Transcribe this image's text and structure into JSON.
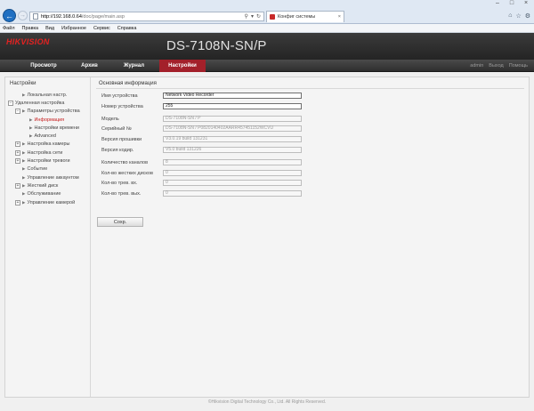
{
  "browser": {
    "url_host": "http://192.168.0.64",
    "url_path": "/doc/page/main.asp",
    "tab_title": "Конфиг системы",
    "menu": [
      "Файл",
      "Правка",
      "Вид",
      "Избранное",
      "Сервис",
      "Справка"
    ]
  },
  "header": {
    "logo": "HIKVISION",
    "model": "DS-7108N-SN/P"
  },
  "nav": {
    "tabs": [
      {
        "label": "Просмотр"
      },
      {
        "label": "Архив"
      },
      {
        "label": "Журнал"
      },
      {
        "label": "Настройки"
      }
    ],
    "active_index": 3,
    "user_links": [
      "admin",
      "Выход",
      "Помощь"
    ]
  },
  "sidebar": {
    "title": "Настройки",
    "items": [
      {
        "label": "Локальная настр.",
        "level": 1,
        "expander": ""
      },
      {
        "label": "Удаленная настройка",
        "level": 0,
        "expander": "−"
      },
      {
        "label": "Параметры устройства",
        "level": 1,
        "expander": "−"
      },
      {
        "label": "Информация",
        "level": 2,
        "expander": "",
        "active": true
      },
      {
        "label": "Настройки времени",
        "level": 2,
        "expander": ""
      },
      {
        "label": "Advanced",
        "level": 2,
        "expander": ""
      },
      {
        "label": "Настройка камеры",
        "level": 1,
        "expander": "+"
      },
      {
        "label": "Настройка сети",
        "level": 1,
        "expander": "+"
      },
      {
        "label": "Настройки тревоги",
        "level": 1,
        "expander": "+"
      },
      {
        "label": "Событие",
        "level": 1,
        "expander": ""
      },
      {
        "label": "Управление аккаунтом",
        "level": 1,
        "expander": ""
      },
      {
        "label": "Жесткий диск",
        "level": 1,
        "expander": "+"
      },
      {
        "label": "Обслуживание",
        "level": 1,
        "expander": ""
      },
      {
        "label": "Управление камерой",
        "level": 1,
        "expander": "+"
      }
    ]
  },
  "main": {
    "section_title": "Основная информация",
    "fields": [
      {
        "label": "Имя устройства",
        "value": "Network Video Recorder",
        "editable": true
      },
      {
        "label": "Номер устройства",
        "value": "255",
        "editable": true
      },
      {
        "label": "Модель",
        "value": "DS-7108N-SN / P",
        "editable": false
      },
      {
        "label": "Серийный №",
        "value": "DS-7108N-SN / P0820140402AARR457451152WCVU",
        "editable": false
      },
      {
        "label": "Версия прошивки",
        "value": "V3.0.19 build 131231",
        "editable": false
      },
      {
        "label": "Версия кодир.",
        "value": "V5.0 build 131226",
        "editable": false
      },
      {
        "label": "Количество каналов",
        "value": "8",
        "editable": false
      },
      {
        "label": "Кол-во жестких дисков",
        "value": "0",
        "editable": false
      },
      {
        "label": "Кол-во трев. вх.",
        "value": "0",
        "editable": false
      },
      {
        "label": "Кол-во трев. вых.",
        "value": "0",
        "editable": false
      }
    ],
    "save_label": "Сохр."
  },
  "footer": {
    "copyright": "©Hikvision Digital Technology Co., Ltd. All Rights Reserved."
  }
}
